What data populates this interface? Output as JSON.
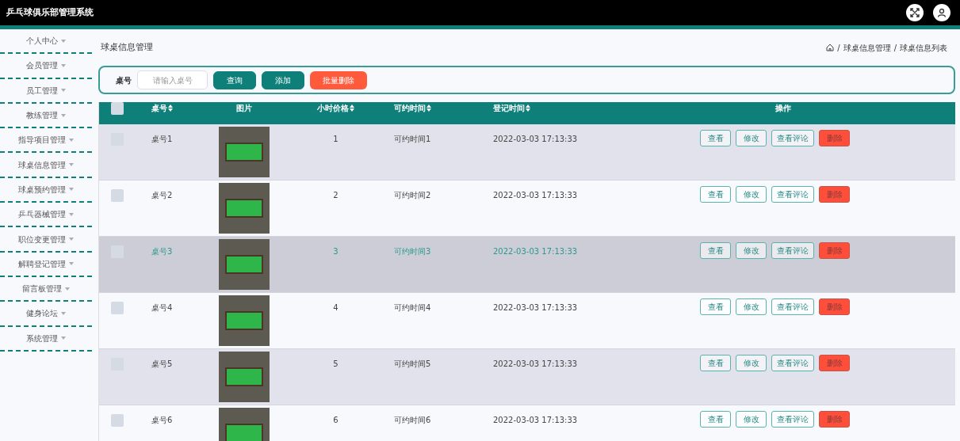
{
  "app": {
    "title": "乒乓球俱乐部管理系统"
  },
  "sidebar": {
    "items": [
      {
        "label": "个人中心"
      },
      {
        "label": "会员管理"
      },
      {
        "label": "员工管理"
      },
      {
        "label": "教练管理"
      },
      {
        "label": "指导项目管理"
      },
      {
        "label": "球桌信息管理"
      },
      {
        "label": "球桌预约管理"
      },
      {
        "label": "乒乓器械管理"
      },
      {
        "label": "职位变更管理"
      },
      {
        "label": "解聘登记管理"
      },
      {
        "label": "留言板管理"
      },
      {
        "label": "健身论坛"
      },
      {
        "label": "系统管理"
      }
    ]
  },
  "page": {
    "title": "球桌信息管理",
    "breadcrumb_separator": "/",
    "breadcrumb": [
      "球桌信息管理",
      "球桌信息列表"
    ]
  },
  "search": {
    "label": "桌号",
    "placeholder": "请输入桌号",
    "buttons": [
      {
        "label": "查询",
        "kind": "primary"
      },
      {
        "label": "添加",
        "kind": "primary"
      },
      {
        "label": "批量删除",
        "kind": "danger"
      }
    ]
  },
  "table": {
    "select_all": {
      "checked": false
    },
    "columns": [
      {
        "label": "桌号",
        "sortable": true
      },
      {
        "label": "图片",
        "sortable": false
      },
      {
        "label": "小时价格",
        "sortable": true
      },
      {
        "label": "可约时间",
        "sortable": true
      },
      {
        "label": "登记时间",
        "sortable": true
      },
      {
        "label": "操作",
        "sortable": false
      }
    ],
    "rows": [
      {
        "id": "桌号1",
        "price": "1",
        "available": "可约时间1",
        "registered": "2022-03-03 17:13:33",
        "selected": false,
        "actions": [
          {
            "label": "查看",
            "kind": "outline"
          },
          {
            "label": "修改",
            "kind": "outline"
          },
          {
            "label": "查看评论",
            "kind": "outline"
          },
          {
            "label": "删除",
            "kind": "danger"
          }
        ]
      },
      {
        "id": "桌号2",
        "price": "2",
        "available": "可约时间2",
        "registered": "2022-03-03 17:13:33",
        "selected": false,
        "actions": [
          {
            "label": "查看",
            "kind": "outline"
          },
          {
            "label": "修改",
            "kind": "outline"
          },
          {
            "label": "查看评论",
            "kind": "outline"
          },
          {
            "label": "删除",
            "kind": "danger"
          }
        ]
      },
      {
        "id": "桌号3",
        "price": "3",
        "available": "可约时间3",
        "registered": "2022-03-03 17:13:33",
        "selected": true,
        "actions": [
          {
            "label": "查看",
            "kind": "outline"
          },
          {
            "label": "修改",
            "kind": "outline"
          },
          {
            "label": "查看评论",
            "kind": "outline"
          },
          {
            "label": "删除",
            "kind": "danger"
          }
        ]
      },
      {
        "id": "桌号4",
        "price": "4",
        "available": "可约时间4",
        "registered": "2022-03-03 17:13:33",
        "selected": false,
        "actions": [
          {
            "label": "查看",
            "kind": "outline"
          },
          {
            "label": "修改",
            "kind": "outline"
          },
          {
            "label": "查看评论",
            "kind": "outline"
          },
          {
            "label": "删除",
            "kind": "danger"
          }
        ]
      },
      {
        "id": "桌号5",
        "price": "5",
        "available": "可约时间5",
        "registered": "2022-03-03 17:13:33",
        "selected": false,
        "actions": [
          {
            "label": "查看",
            "kind": "outline"
          },
          {
            "label": "修改",
            "kind": "outline"
          },
          {
            "label": "查看评论",
            "kind": "outline"
          },
          {
            "label": "删除",
            "kind": "danger"
          }
        ]
      },
      {
        "id": "桌号6",
        "price": "6",
        "available": "可约时间6",
        "registered": "2022-03-03 17:13:33",
        "selected": false,
        "actions": [
          {
            "label": "查看",
            "kind": "outline"
          },
          {
            "label": "修改",
            "kind": "outline"
          },
          {
            "label": "查看评论",
            "kind": "outline"
          },
          {
            "label": "删除",
            "kind": "danger"
          }
        ]
      }
    ]
  }
}
